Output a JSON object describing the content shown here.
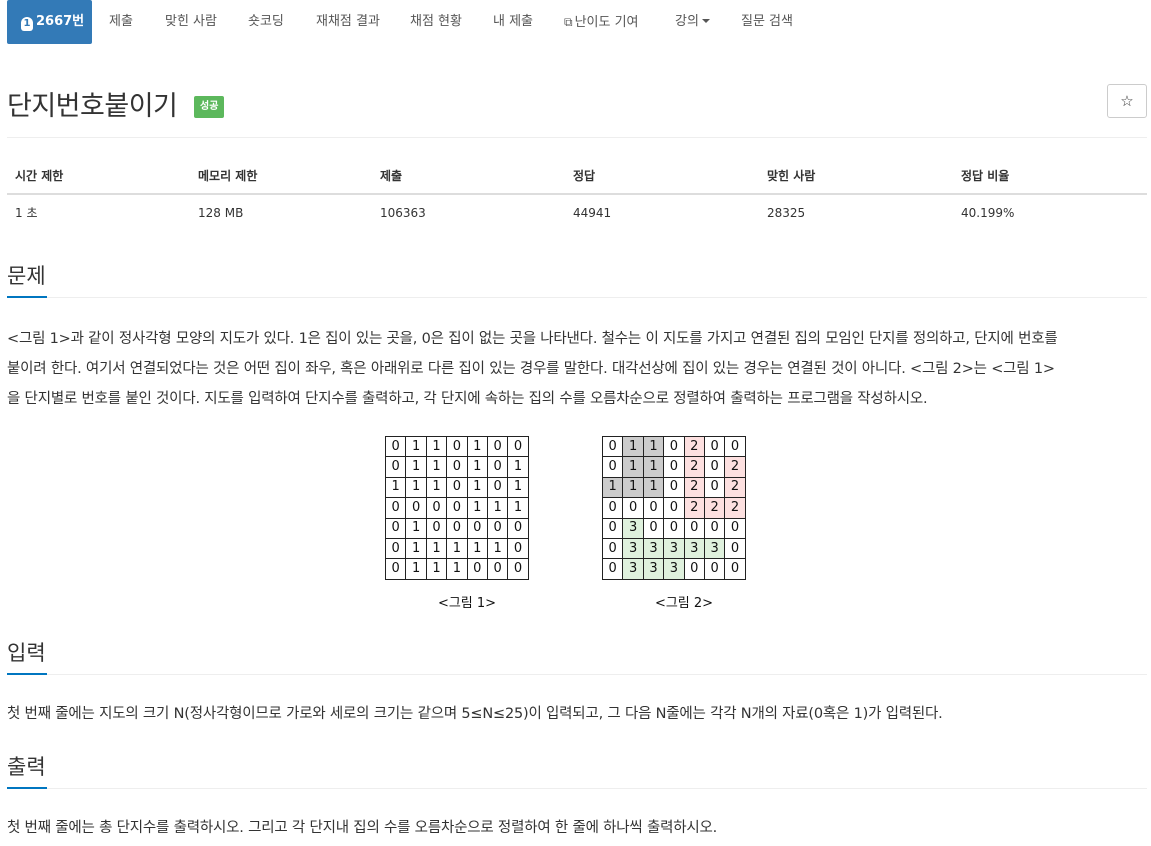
{
  "nav": {
    "problem_number": "2667번",
    "badge": "1",
    "tabs": [
      "제출",
      "맞힌 사람",
      "숏코딩",
      "재채점 결과",
      "채점 현황",
      "내 제출",
      "난이도 기여",
      "강의",
      "질문 검색"
    ]
  },
  "problem": {
    "title": "단지번호붙이기",
    "status": "성공",
    "star": "☆"
  },
  "stats": {
    "headers": [
      "시간 제한",
      "메모리 제한",
      "제출",
      "정답",
      "맞힌 사람",
      "정답 비율"
    ],
    "values": [
      "1 초",
      "128 MB",
      "106363",
      "44941",
      "28325",
      "40.199%"
    ]
  },
  "sections": {
    "problem": {
      "heading": "문제",
      "lines": [
        "<그림 1>과 같이 정사각형 모양의 지도가 있다. 1은 집이 있는 곳을, 0은 집이 없는 곳을 나타낸다. 철수는 이 지도를 가지고 연결된 집의 모임인 단지를 정의하고, 단지에 번호를",
        "붙이려 한다. 여기서 연결되었다는 것은 어떤 집이 좌우, 혹은 아래위로 다른 집이 있는 경우를 말한다. 대각선상에 집이 있는 경우는 연결된 것이 아니다. <그림 2>는 <그림 1>",
        "을 단지별로 번호를 붙인 것이다. 지도를 입력하여 단지수를 출력하고, 각 단지에 속하는 집의 수를 오름차순으로 정렬하여 출력하는 프로그램을 작성하시오."
      ]
    },
    "input": {
      "heading": "입력",
      "text": "첫 번째 줄에는 지도의 크기 N(정사각형이므로 가로와 세로의 크기는 같으며 5≤N≤25)이 입력되고, 그 다음 N줄에는 각각 N개의 자료(0혹은 1)가 입력된다."
    },
    "output": {
      "heading": "출력",
      "text": "첫 번째 줄에는 총 단지수를 출력하시오. 그리고 각 단지내 집의 수를 오름차순으로 정렬하여 한 줄에 하나씩 출력하시오."
    }
  },
  "figures": {
    "fig1": {
      "caption": "<그림 1>",
      "grid": [
        [
          "0",
          "1",
          "1",
          "0",
          "1",
          "0",
          "0"
        ],
        [
          "0",
          "1",
          "1",
          "0",
          "1",
          "0",
          "1"
        ],
        [
          "1",
          "1",
          "1",
          "0",
          "1",
          "0",
          "1"
        ],
        [
          "0",
          "0",
          "0",
          "0",
          "1",
          "1",
          "1"
        ],
        [
          "0",
          "1",
          "0",
          "0",
          "0",
          "0",
          "0"
        ],
        [
          "0",
          "1",
          "1",
          "1",
          "1",
          "1",
          "0"
        ],
        [
          "0",
          "1",
          "1",
          "1",
          "0",
          "0",
          "0"
        ]
      ]
    },
    "fig2": {
      "caption": "<그림 2>",
      "grid": [
        [
          "0",
          "1",
          "1",
          "0",
          "2",
          "0",
          "0"
        ],
        [
          "0",
          "1",
          "1",
          "0",
          "2",
          "0",
          "2"
        ],
        [
          "1",
          "1",
          "1",
          "0",
          "2",
          "0",
          "2"
        ],
        [
          "0",
          "0",
          "0",
          "0",
          "2",
          "2",
          "2"
        ],
        [
          "0",
          "3",
          "0",
          "0",
          "0",
          "0",
          "0"
        ],
        [
          "0",
          "3",
          "3",
          "3",
          "3",
          "3",
          "0"
        ],
        [
          "0",
          "3",
          "3",
          "3",
          "0",
          "0",
          "0"
        ]
      ]
    },
    "colors": {
      "1": "#cccccc",
      "2": "#fde0e0",
      "3": "#dff1dd"
    }
  }
}
